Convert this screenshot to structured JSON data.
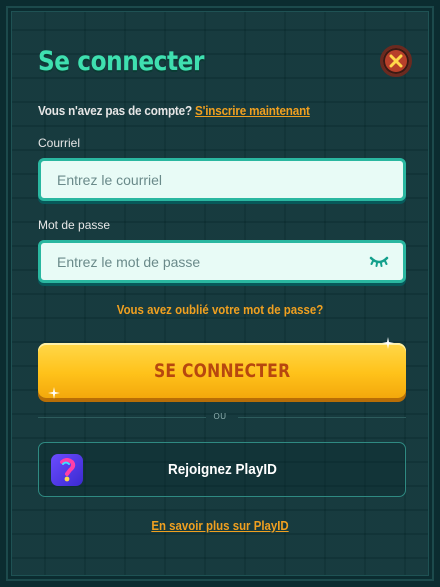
{
  "dialog": {
    "title": "Se connecter"
  },
  "signup": {
    "prompt": "Vous n'avez pas de compte?",
    "link_label": "S'inscrire maintenant"
  },
  "email": {
    "label": "Courriel",
    "placeholder": "Entrez le courriel",
    "value": ""
  },
  "password": {
    "label": "Mot de passe",
    "placeholder": "Entrez le mot de passe",
    "value": ""
  },
  "forgot_password_label": "Vous avez oublié votre mot de passe?",
  "connect_button_label": "SE CONNECTER",
  "or_label": "OU",
  "playid": {
    "button_label": "Rejoignez PlayID",
    "learn_more_label": "En savoir plus sur PlayID"
  },
  "icons": {
    "close": "close-icon",
    "eye": "eye-closed-icon",
    "playid": "playid-logo-icon",
    "sparkle": "sparkle-icon"
  },
  "colors": {
    "title": "#3fe0b0",
    "accent": "#f0a020",
    "button": "#ffc21a",
    "input_border": "#2ab7a0",
    "background": "#0f3438"
  }
}
